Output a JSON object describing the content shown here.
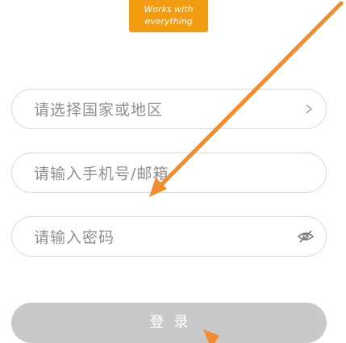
{
  "badge": {
    "line1": "Works with",
    "line2": "everything"
  },
  "form": {
    "region": {
      "placeholder": "请选择国家或地区",
      "icon": "chevron-right-icon"
    },
    "account": {
      "placeholder": "请输入手机号/邮箱"
    },
    "password": {
      "placeholder": "请输入密码",
      "icon": "eye-off-icon"
    },
    "login_label": "登录"
  },
  "colors": {
    "accent": "#f39c12",
    "arrow": "#f28c2c",
    "button_disabled": "#c9c9c9",
    "border": "#d9d9d9",
    "placeholder": "#8f8f8f"
  }
}
